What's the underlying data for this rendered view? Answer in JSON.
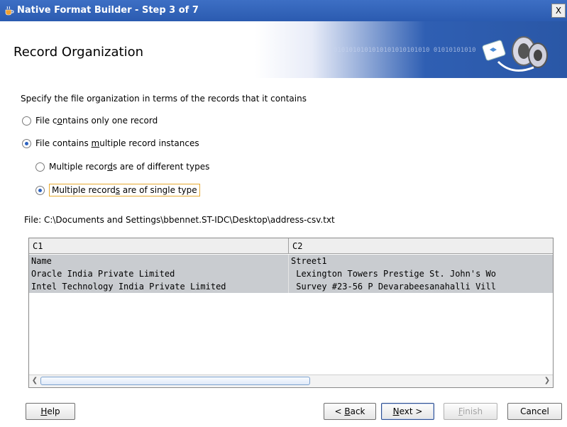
{
  "window": {
    "title": "Native Format Builder - Step 3 of 7",
    "close_label": "X"
  },
  "header": {
    "title": "Record Organization",
    "binary_text": "0101010101010101010101010 01010101010"
  },
  "instruction": "Specify the file organization in terms of the records that it contains",
  "options": {
    "one_record": {
      "pre": "File c",
      "ul": "o",
      "post": "ntains only one record",
      "selected": false
    },
    "multiple": {
      "pre": "File contains ",
      "ul": "m",
      "post": "ultiple record instances",
      "selected": true
    },
    "different_types": {
      "pre": "Multiple recor",
      "ul": "d",
      "post": "s are of different types",
      "selected": false
    },
    "single_type": {
      "pre": "Multiple record",
      "ul": "s",
      "post": " are of single type",
      "selected": true
    }
  },
  "file_label": "File: C:\\Documents and Settings\\bbennet.ST-IDC\\Desktop\\address-csv.txt",
  "grid": {
    "columns": [
      "C1",
      "C2"
    ],
    "rows": [
      [
        "Name",
        "Street1"
      ],
      [
        "Oracle India Private Limited",
        " Lexington Towers Prestige St. John's Wo"
      ],
      [
        "Intel Technology India Private Limited",
        " Survey #23-56 P Devarabeesanahalli Vill"
      ]
    ]
  },
  "buttons": {
    "help": {
      "ul": "H",
      "post": "elp"
    },
    "back": {
      "pre": "< ",
      "ul": "B",
      "post": "ack"
    },
    "next": {
      "ul": "N",
      "post": "ext >"
    },
    "finish": {
      "ul": "F",
      "post": "inish"
    },
    "cancel": {
      "label": "Cancel"
    }
  },
  "colors": {
    "title_bar": "#2b5bb0",
    "selection": "#c9ccd0",
    "focus": "#e6a92f"
  }
}
